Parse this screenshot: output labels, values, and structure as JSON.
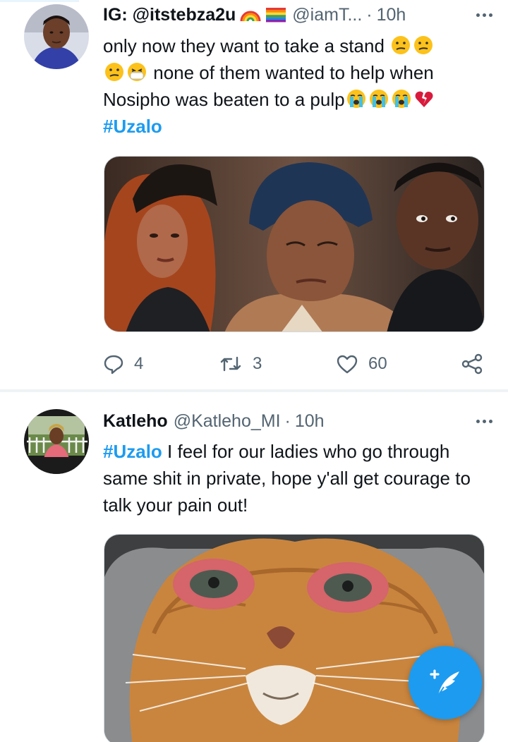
{
  "tweets": [
    {
      "display_name": "IG: @itstebza2u",
      "handle": "@iamT...",
      "separator": "·",
      "time": "10h",
      "text_parts": {
        "line1": "only now they want to take a stand",
        "line2": "none of them wanted to help when",
        "line3": "Nosipho was beaten to a pulp"
      },
      "hashtag": "#Uzalo",
      "emojis": [
        "confused-face",
        "confused-face",
        "confused-face",
        "face-with-medical-mask",
        "loudly-crying-face",
        "loudly-crying-face",
        "loudly-crying-face",
        "broken-heart"
      ],
      "media_description_icon": "tv-scene-photo",
      "replies": "4",
      "retweets": "3",
      "likes": "60"
    },
    {
      "display_name": "Katleho",
      "handle": "@Katleho_MI",
      "separator": "·",
      "time": "10h",
      "hashtag": "#Uzalo",
      "text": " I feel for our ladies who go through same shit in private, hope y'all get courage to talk your pain out!",
      "media_description_icon": "crying-cat-photo"
    }
  ],
  "colors": {
    "accent": "#1d9bf0",
    "text": "#0f1419",
    "muted": "#536471",
    "divider": "#eff3f4"
  },
  "icons": [
    "reply-icon",
    "retweet-icon",
    "like-icon",
    "share-icon",
    "more-icon",
    "compose-tweet-icon"
  ]
}
